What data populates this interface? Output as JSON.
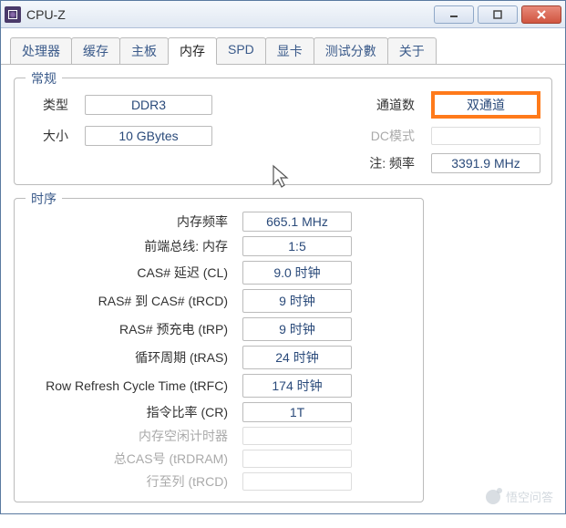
{
  "window": {
    "title": "CPU-Z"
  },
  "tabs": {
    "items": [
      {
        "label": "处理器"
      },
      {
        "label": "缓存"
      },
      {
        "label": "主板"
      },
      {
        "label": "内存"
      },
      {
        "label": "SPD"
      },
      {
        "label": "显卡"
      },
      {
        "label": "测试分數"
      },
      {
        "label": "关于"
      }
    ],
    "active_index": 3
  },
  "general": {
    "title": "常规",
    "type_label": "类型",
    "type_value": "DDR3",
    "size_label": "大小",
    "size_value": "10 GBytes",
    "channels_label": "通道数",
    "channels_value": "双通道",
    "dc_mode_label": "DC模式",
    "dc_mode_value": "",
    "nb_freq_label": "注: 频率",
    "nb_freq_value": "3391.9 MHz"
  },
  "timings": {
    "title": "时序",
    "rows": [
      {
        "label": "内存频率",
        "value": "665.1 MHz",
        "gray": false
      },
      {
        "label": "前端总线: 内存",
        "value": "1:5",
        "gray": false
      },
      {
        "label": "CAS# 延迟 (CL)",
        "value": "9.0 时钟",
        "gray": false
      },
      {
        "label": "RAS# 到 CAS# (tRCD)",
        "value": "9 时钟",
        "gray": false
      },
      {
        "label": "RAS# 预充电 (tRP)",
        "value": "9 时钟",
        "gray": false
      },
      {
        "label": "循环周期 (tRAS)",
        "value": "24 时钟",
        "gray": false
      },
      {
        "label": "Row Refresh Cycle Time (tRFC)",
        "value": "174 时钟",
        "gray": false
      },
      {
        "label": "指令比率 (CR)",
        "value": "1T",
        "gray": false
      },
      {
        "label": "内存空闲计时器",
        "value": "",
        "gray": true
      },
      {
        "label": "总CAS号 (tRDRAM)",
        "value": "",
        "gray": true
      },
      {
        "label": "行至列 (tRCD)",
        "value": "",
        "gray": true
      }
    ]
  },
  "watermark": "悟空问答"
}
